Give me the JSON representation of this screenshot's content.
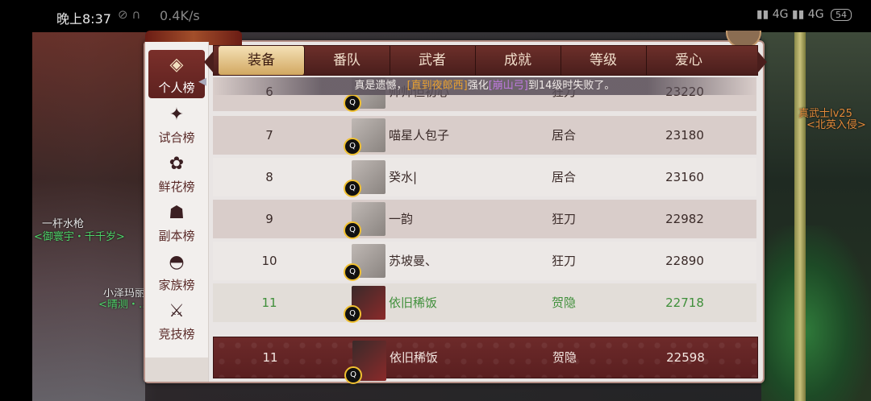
{
  "status_bar": {
    "time": "晚上8:37",
    "net_speed": "0.4K/s",
    "signal_1": "4G",
    "signal_2": "4G",
    "battery": "54"
  },
  "scene": {
    "npcs": [
      {
        "name": "一杆水枪",
        "tag": "<御寰宇・千千岁>"
      },
      {
        "name": "小泽玛丽",
        "tag": "<晴测・…>"
      },
      {
        "name": "真武士lv25",
        "tag": "<北英入侵>"
      }
    ]
  },
  "left_nav": [
    {
      "label": "个人榜",
      "icon": "badge-icon",
      "active": true
    },
    {
      "label": "试合榜",
      "icon": "shuriken-icon",
      "active": false
    },
    {
      "label": "鲜花榜",
      "icon": "rose-icon",
      "active": false
    },
    {
      "label": "副本榜",
      "icon": "oni-mask-icon",
      "active": false
    },
    {
      "label": "家族榜",
      "icon": "fan-icon",
      "active": false
    },
    {
      "label": "竞技榜",
      "icon": "crossed-swords-icon",
      "active": false
    }
  ],
  "tabs": [
    {
      "label": "装备",
      "active": true
    },
    {
      "label": "番队",
      "active": false
    },
    {
      "label": "武者",
      "active": false
    },
    {
      "label": "成就",
      "active": false
    },
    {
      "label": "等级",
      "active": false
    },
    {
      "label": "爱心",
      "active": false
    }
  ],
  "notice": {
    "prefix": "真是遗憾，",
    "player": "[直到夜郎西]",
    "middle": "强化",
    "item": "[崩山弓]",
    "suffix": "到14级时失败了。"
  },
  "rows": [
    {
      "rank": "6",
      "name": "帅帅但初心",
      "sect": "狂刀",
      "score": "23220"
    },
    {
      "rank": "7",
      "name": "喵星人包子",
      "sect": "居合",
      "score": "23180"
    },
    {
      "rank": "8",
      "name": "癸水|",
      "sect": "居合",
      "score": "23160"
    },
    {
      "rank": "9",
      "name": "一韵",
      "sect": "狂刀",
      "score": "22982"
    },
    {
      "rank": "10",
      "name": "苏坡曼、",
      "sect": "狂刀",
      "score": "22890"
    },
    {
      "rank": "11",
      "name": "依旧稀饭",
      "sect": "贺隐",
      "score": "22718"
    }
  ],
  "my_rank": {
    "rank": "11",
    "name": "依旧稀饭",
    "sect": "贺隐",
    "score": "22598"
  },
  "colors": {
    "accent": "#6d2a2a",
    "highlight_green": "#3f8f3a",
    "tab_gold": "#d2a861"
  }
}
